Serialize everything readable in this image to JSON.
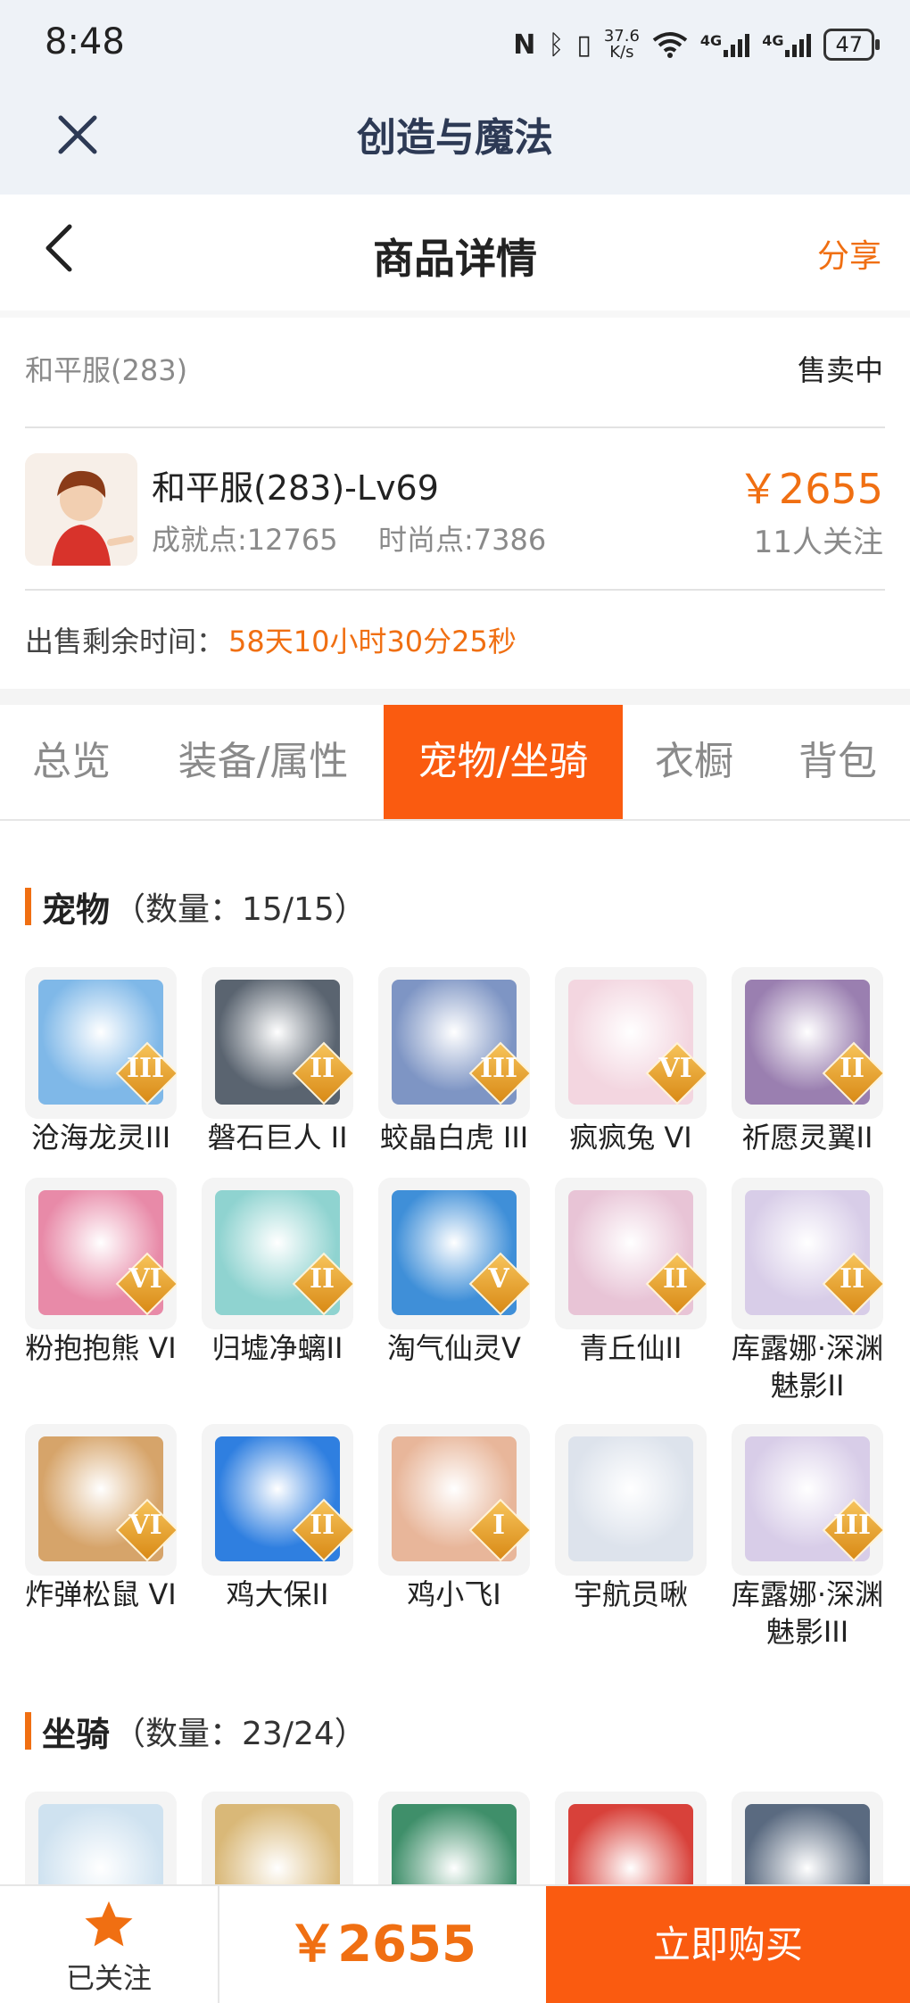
{
  "status_bar": {
    "time": "8:48",
    "network_speed": "37.6\nK/s",
    "net1": "4G",
    "net2": "4G",
    "battery": "47"
  },
  "app_bar": {
    "title": "创造与魔法"
  },
  "page_header": {
    "title": "商品详情",
    "share_label": "分享"
  },
  "listing": {
    "server": "和平服(283)",
    "status": "售卖中",
    "character_name": "和平服(283)-Lv69",
    "achievement": "成就点:12765",
    "fashion": "时尚点:7386",
    "price": "￥2655",
    "followers": "11人关注",
    "remaining_label": "出售剩余时间：",
    "remaining_value": "58天10小时30分25秒"
  },
  "tabs": [
    {
      "label": "总览",
      "active": false
    },
    {
      "label": "装备/属性",
      "active": false
    },
    {
      "label": "宠物/坐骑",
      "active": true
    },
    {
      "label": "衣橱",
      "active": false
    },
    {
      "label": "背包",
      "active": false
    }
  ],
  "pets_section": {
    "title": "宠物",
    "count": "（数量：15/15）"
  },
  "pets": [
    {
      "name": "沧海龙灵III",
      "level": "III",
      "color": "#7fb8e8",
      "icon": "dragon-spirit-icon"
    },
    {
      "name": "磐石巨人 II",
      "level": "II",
      "color": "#5a6470",
      "icon": "rock-giant-icon"
    },
    {
      "name": "蛟晶白虎 III",
      "level": "III",
      "color": "#7e95c4",
      "icon": "white-tiger-icon"
    },
    {
      "name": "疯疯兔 VI",
      "level": "VI",
      "color": "#f3d6e0",
      "icon": "rabbit-icon"
    },
    {
      "name": "祈愿灵翼II",
      "level": "II",
      "color": "#9a7fb0",
      "icon": "winged-bird-icon"
    },
    {
      "name": "粉抱抱熊 VI",
      "level": "VI",
      "color": "#e88aa8",
      "icon": "pink-bear-icon"
    },
    {
      "name": "归墟净螭II",
      "level": "II",
      "color": "#8fd3d0",
      "icon": "sea-dragon-icon"
    },
    {
      "name": "淘气仙灵V",
      "level": "V",
      "color": "#3f8fd8",
      "icon": "blue-puppy-icon"
    },
    {
      "name": "青丘仙II",
      "level": "II",
      "color": "#e8c4d6",
      "icon": "fox-fairy-icon"
    },
    {
      "name": "库露娜·深渊魅影II",
      "level": "II",
      "color": "#d8cde8",
      "icon": "kuluna-icon"
    },
    {
      "name": "炸弹松鼠 VI",
      "level": "VI",
      "color": "#d6a46a",
      "icon": "squirrel-icon"
    },
    {
      "name": "鸡大保II",
      "level": "II",
      "color": "#2f7fe0",
      "icon": "blue-bird-icon"
    },
    {
      "name": "鸡小飞I",
      "level": "I",
      "color": "#e8b69a",
      "icon": "chick-icon"
    },
    {
      "name": "宇航员啾",
      "level": "",
      "color": "#dde3ec",
      "icon": "astronaut-icon"
    },
    {
      "name": "库露娜·深渊魅影III",
      "level": "III",
      "color": "#d8cde8",
      "icon": "kuluna-icon"
    }
  ],
  "mounts_section": {
    "title": "坐骑",
    "count": "（数量：23/24）"
  },
  "mounts": [
    {
      "color": "#cfe2f0",
      "icon": "white-horse-icon"
    },
    {
      "color": "#d9b878",
      "icon": "owl-icon"
    },
    {
      "color": "#3f8f6a",
      "icon": "green-dragon-icon"
    },
    {
      "color": "#d8413a",
      "icon": "drum-icon"
    },
    {
      "color": "#5a6a80",
      "icon": "shovel-icon"
    }
  ],
  "bottom_bar": {
    "follow_label": "已关注",
    "price": "￥2655",
    "buy_label": "立即购买"
  },
  "colors": {
    "accent": "#fa5b10",
    "price": "#f06f12"
  }
}
